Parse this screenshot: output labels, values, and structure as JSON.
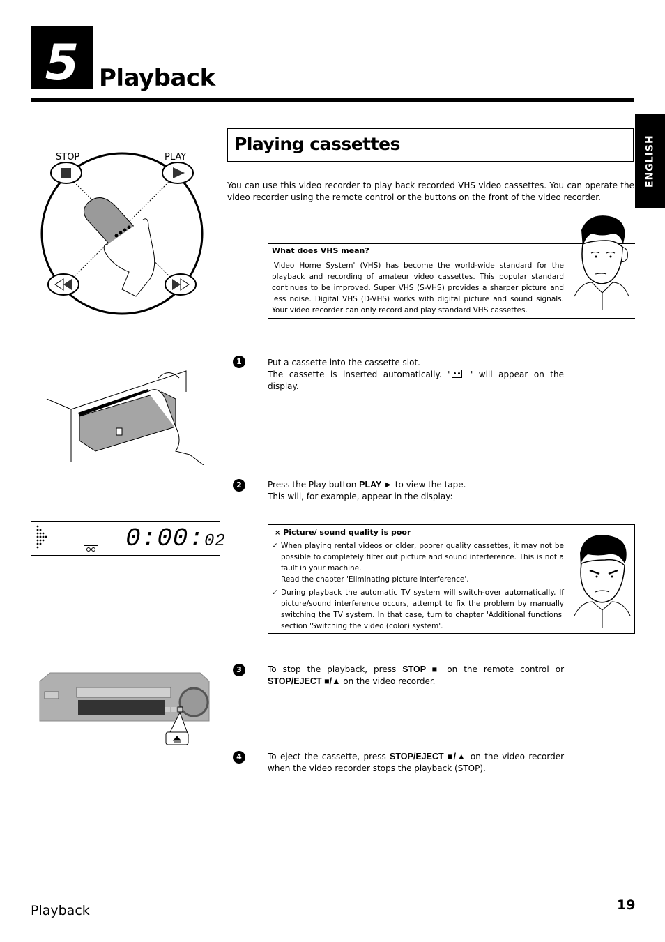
{
  "chapter": {
    "number": "5",
    "title": "Playback"
  },
  "language_tab": "ENGLISH",
  "section": {
    "title": "Playing cassettes",
    "intro": "You can use this video recorder to play back recorded VHS video cassettes. You can operate the video recorder using the remote control or the buttons on the front of the video recorder."
  },
  "illustrations": {
    "remote_labels": {
      "stop": "STOP",
      "play": "PLAY"
    },
    "lcd": {
      "time_main": "0:00:",
      "time_seconds": "02"
    }
  },
  "vhs_box": {
    "title": "What does VHS mean?",
    "text": "'Video Home System' (VHS) has become the world-wide standard for the playback and recording of amateur video cassettes. This popular standard continues to be improved. Super VHS (S-VHS) provides a sharper picture and less noise. Digital VHS (D-VHS) works with digital picture and sound signals. Your video recorder can only record and play standard VHS cassettes."
  },
  "steps": [
    {
      "number": "1",
      "line1": "Put a cassette into the cassette slot.",
      "line2_before": "The cassette is inserted automatically. '",
      "line2_after": " ' will appear on the display."
    },
    {
      "number": "2",
      "before": "Press the Play button ",
      "key": "PLAY ►",
      "after": " to view the tape.",
      "line2": "This will, for example, appear in the display:"
    },
    {
      "number": "3",
      "before": "To stop the playback, press ",
      "key1": "STOP ■",
      "middle": " on the remote control or ",
      "key2": "STOP/EJECT ■/▲",
      "after": " on the video recorder."
    },
    {
      "number": "4",
      "before": "To eject the cassette, press ",
      "key": "STOP/EJECT ■/▲",
      "after": " on the video recorder when the video recorder stops the playback (STOP)."
    }
  ],
  "troubleshoot": {
    "marker": "×",
    "title": "Picture/ sound quality is poor",
    "items": [
      {
        "check": "✓",
        "text": "When playing rental videos or older, poorer quality cassettes, it may not be possible to completely filter out picture and sound interference. This is not a fault in your machine.",
        "note": "Read the chapter 'Eliminating picture interference'."
      },
      {
        "check": "✓",
        "text": "During playback the automatic TV system will switch-over automatically. If picture/sound interference occurs, attempt to fix the problem by manually switching the TV system. In that case, turn to chapter 'Additional functions' section 'Switching the video (color) system'."
      }
    ]
  },
  "footer": {
    "label": "Playback",
    "page": "19"
  }
}
